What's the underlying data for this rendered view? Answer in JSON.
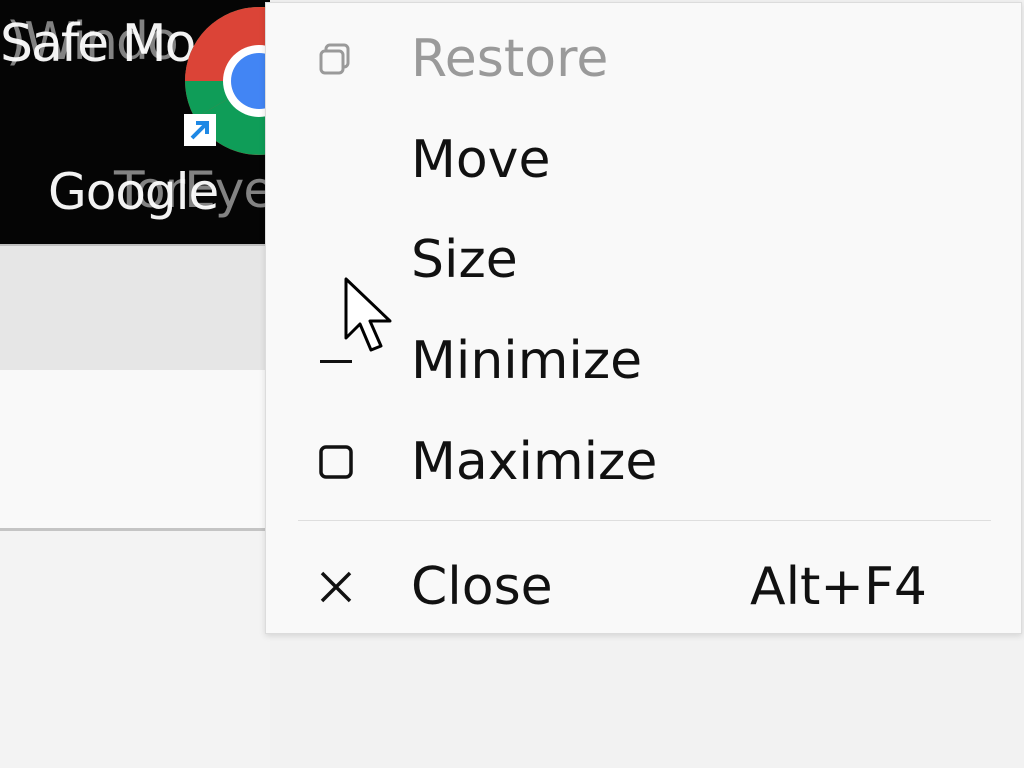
{
  "desktop": {
    "icon_label_top": "Safe Mode",
    "icon_label_top_ghost": ")Windo",
    "icon_label_bottom": "Google",
    "icon_label_bottom_ghost": "TorEye",
    "icon": "google-chrome-icon",
    "shortcut_overlay": "shortcut-arrow-icon"
  },
  "context_menu": {
    "items": [
      {
        "label": "Restore",
        "icon": "restore-icon",
        "enabled": false,
        "accelerator": ""
      },
      {
        "label": "Move",
        "icon": "",
        "enabled": true,
        "accelerator": ""
      },
      {
        "label": "Size",
        "icon": "",
        "enabled": true,
        "accelerator": ""
      },
      {
        "label": "Minimize",
        "icon": "minimize-icon",
        "enabled": true,
        "accelerator": ""
      },
      {
        "label": "Maximize",
        "icon": "maximize-icon",
        "enabled": true,
        "accelerator": ""
      },
      {
        "label": "Close",
        "icon": "close-icon",
        "enabled": true,
        "accelerator": "Alt+F4"
      }
    ]
  },
  "cursor": "arrow-cursor-icon",
  "colors": {
    "menu_background": "#f9f9f9",
    "menu_text": "#111111",
    "disabled_text": "#9a9a9a",
    "desktop_background": "#050505",
    "separator": "#dedede"
  }
}
